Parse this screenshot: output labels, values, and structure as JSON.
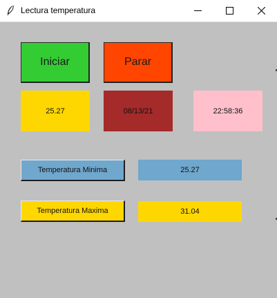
{
  "window": {
    "title": "Lectura temperatura",
    "controls": {
      "minimize": "minimize-icon",
      "maximize": "maximize-icon",
      "close": "close-icon"
    }
  },
  "buttons": {
    "iniciar": "Iniciar",
    "parar": "Parar",
    "temp_min": "Temperatura Minima",
    "temp_max": "Temperatura Maxima"
  },
  "readings": {
    "current_temp": "25.27",
    "date": "08/13/21",
    "time": "22:58:36",
    "min_value": "25.27",
    "max_value": "31.04"
  },
  "colors": {
    "window_bg": "#c0c0c0",
    "iniciar_bg": "#33cc33",
    "parar_bg": "#ff4500",
    "temp_bg": "#ffd700",
    "date_bg": "#a52a2a",
    "time_bg": "#ffc0cb",
    "min_bg": "#6fa7cd",
    "max_bg": "#ffd700"
  }
}
